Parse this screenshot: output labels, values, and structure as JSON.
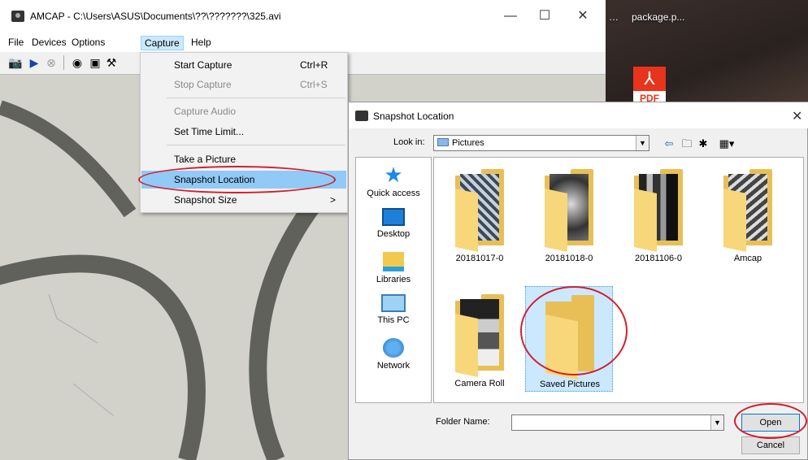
{
  "amcap": {
    "title": "AMCAP - C:\\Users\\ASUS\\Documents\\??\\???????\\325.avi",
    "window_buttons": {
      "minimize": "—",
      "maximize": "☐",
      "close": "✕"
    },
    "menu": [
      "File",
      "Devices",
      "Options",
      "Capture",
      "Help"
    ]
  },
  "capture_menu": {
    "items": [
      {
        "label": "Start Capture",
        "shortcut": "Ctrl+R",
        "disabled": false
      },
      {
        "label": "Stop Capture",
        "shortcut": "Ctrl+S",
        "disabled": true
      },
      {
        "label": "Capture Audio",
        "shortcut": "",
        "disabled": true
      },
      {
        "label": "Set Time Limit...",
        "shortcut": "",
        "disabled": false
      },
      {
        "label": "Take a Picture",
        "shortcut": "",
        "disabled": false
      },
      {
        "label": "Snapshot Location",
        "shortcut": "",
        "disabled": false
      },
      {
        "label": "Snapshot Size",
        "shortcut": ">",
        "disabled": false
      }
    ]
  },
  "desktop": {
    "icon1_label": "…",
    "icon2_label": "package.p...",
    "icon3_label": "PDF"
  },
  "dialog": {
    "title": "Snapshot Location",
    "close": "✕",
    "look_in_label": "Look in:",
    "look_in_value": "Pictures",
    "places": [
      "Quick access",
      "Desktop",
      "Libraries",
      "This PC",
      "Network"
    ],
    "folders": [
      {
        "name": "20181017-0"
      },
      {
        "name": "20181018-0"
      },
      {
        "name": "20181106-0"
      },
      {
        "name": "Amcap"
      },
      {
        "name": "Camera Roll"
      },
      {
        "name": "Saved Pictures",
        "selected": true
      }
    ],
    "folder_name_label": "Folder Name:",
    "folder_name_value": "",
    "open_button": "Open",
    "cancel_button": "Cancel"
  },
  "colors": {
    "annotation_red": "#d21f2a",
    "menu_highlight": "#91c9f7",
    "folder_yellow": "#e8bf57"
  }
}
